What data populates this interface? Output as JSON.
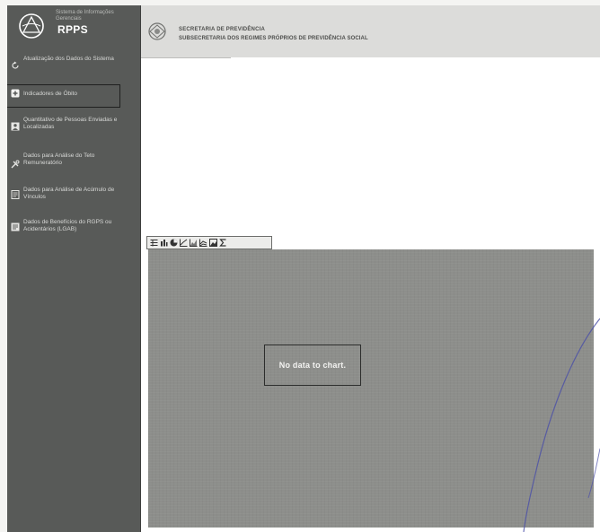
{
  "brand": {
    "subtitle": "Sistema de Informações Gerenciais",
    "title": "RPPS",
    "logo_icon": "globe-logo-icon"
  },
  "sidebar": {
    "items": [
      {
        "label": "Atualização dos Dados do Sistema",
        "icon": "refresh-icon"
      },
      {
        "label": "Indicadores de Óbito",
        "icon": "plus-icon",
        "selected": true
      },
      {
        "label": "Quantitativo de Pessoas Enviadas e Localizadas",
        "icon": "person-icon"
      },
      {
        "label": "Dados para Análise do Teto Remuneratório",
        "icon": "tools-icon"
      },
      {
        "label": "Dados para Análise de Acúmulo de Vínculos",
        "icon": "document-icon"
      },
      {
        "label": "Dados de Benefícios do RGPS ou Acidentários (LGAB)",
        "icon": "list-document-icon"
      }
    ]
  },
  "header": {
    "line1": "SECRETARIA DE PREVIDÊNCIA",
    "line2": "SUBSECRETARIA DOS REGIMES PRÓPRIOS DE PREVIDÊNCIA SOCIAL",
    "logo_icon": "ministry-emblem-icon"
  },
  "toolbar": {
    "buttons": [
      "table-view-icon",
      "bar-chart-icon",
      "pie-chart-icon",
      "line-chart-icon",
      "area-chart-icon",
      "stacked-chart-icon",
      "export-image-icon",
      "sum-icon"
    ]
  },
  "chart": {
    "message": "No data to chart."
  },
  "colors": {
    "sidebar": "#585a58",
    "chart_bg": "#8d8e8b",
    "header_bg": "#dcdcda",
    "pen": "#4a4fa8"
  }
}
